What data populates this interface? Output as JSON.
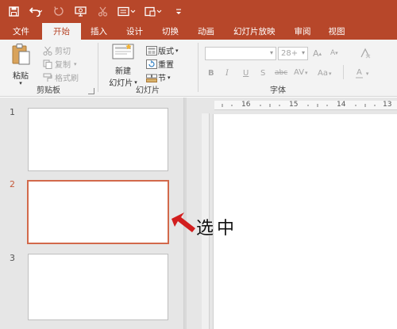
{
  "qat": {
    "icons": [
      "save-icon",
      "undo-icon",
      "redo-icon",
      "slideshow-from-start-icon",
      "cut-icon",
      "screen-icon",
      "layout-icon",
      "customize-qat-icon"
    ]
  },
  "tabs": [
    {
      "label": "文件",
      "active": false
    },
    {
      "label": "开始",
      "active": true
    },
    {
      "label": "插入",
      "active": false
    },
    {
      "label": "设计",
      "active": false
    },
    {
      "label": "切换",
      "active": false
    },
    {
      "label": "动画",
      "active": false
    },
    {
      "label": "幻灯片放映",
      "active": false
    },
    {
      "label": "审阅",
      "active": false
    },
    {
      "label": "视图",
      "active": false
    }
  ],
  "clipboard": {
    "paste_label": "粘贴",
    "cut_label": "剪切",
    "copy_label": "复制",
    "format_painter_label": "格式刷",
    "group_label": "剪贴板"
  },
  "slides_group": {
    "new_slide_line1": "新建",
    "new_slide_line2": "幻灯片",
    "layout_label": "版式",
    "reset_label": "重置",
    "section_label": "节",
    "group_label": "幻灯片"
  },
  "font_group": {
    "font_name": "",
    "font_size": "28+",
    "group_label": "字体",
    "bold": "B",
    "italic": "I",
    "underline": "U",
    "strike": "S",
    "shadow": "abc",
    "spacing": "AV",
    "case": "Aa",
    "color": "A",
    "grow": "A",
    "shrink": "A"
  },
  "ruler": {
    "marks": [
      "16",
      "15",
      "14",
      "13"
    ]
  },
  "slides": [
    {
      "number": "1",
      "selected": false
    },
    {
      "number": "2",
      "selected": true
    },
    {
      "number": "3",
      "selected": false
    }
  ],
  "annotation": {
    "text": "选中"
  },
  "colors": {
    "accent": "#b7472a",
    "selection": "#d2694b",
    "arrow": "#d21e1e"
  }
}
